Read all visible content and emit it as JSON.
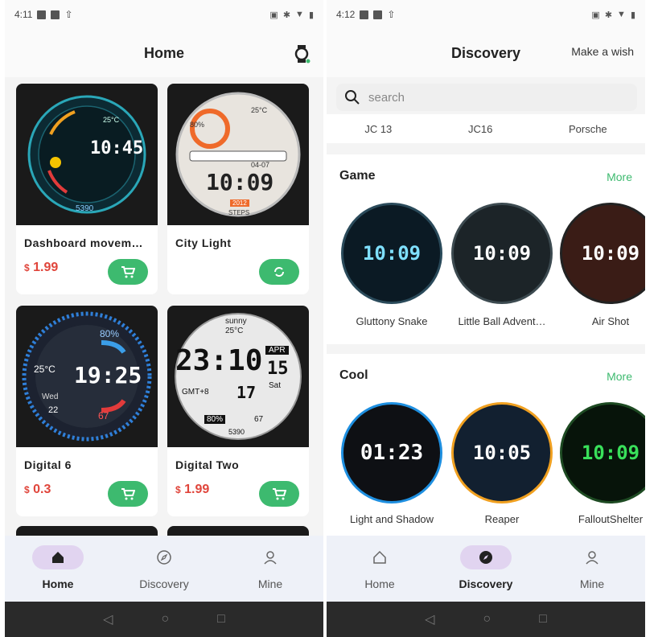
{
  "left": {
    "status": {
      "time": "4:11"
    },
    "header": {
      "title": "Home"
    },
    "cards": [
      {
        "title": "Dashboard movem…",
        "currency": "$",
        "price": "1.99",
        "face": {
          "time": "10:45",
          "info": "25°C",
          "steps": "5390"
        }
      },
      {
        "title": "City Light",
        "currency": "",
        "price": "",
        "face": {
          "time": "10:09",
          "temp": "25°C",
          "date": "04-07",
          "pct": "80%",
          "steps": "2012",
          "steps_label": "STEPS"
        }
      },
      {
        "title": "Digital 6",
        "currency": "$",
        "price": "0.3",
        "face": {
          "time": "19:25",
          "temp": "25°C",
          "day": "Wed",
          "date": "22",
          "pct": "80%",
          "hr": "67"
        }
      },
      {
        "title": "Digital Two",
        "currency": "$",
        "price": "1.99",
        "face": {
          "time": "23:10",
          "weather": "sunny",
          "temp": "25°C",
          "month": "APR",
          "date": "15",
          "day": "Sat",
          "zone": "GMT+8",
          "num": "17",
          "pct": "80%",
          "hr": "67",
          "steps": "5390"
        }
      }
    ],
    "tabs": [
      {
        "label": "Home",
        "icon": "home-icon"
      },
      {
        "label": "Discovery",
        "icon": "compass-icon"
      },
      {
        "label": "Mine",
        "icon": "user-icon"
      }
    ]
  },
  "right": {
    "status": {
      "time": "4:12"
    },
    "header": {
      "title": "Discovery",
      "wish": "Make a wish"
    },
    "search": {
      "placeholder": "search"
    },
    "brands": [
      "JC 13",
      "JC16",
      "Porsche"
    ],
    "game": {
      "title": "Game",
      "more": "More",
      "items": [
        {
          "label": "Gluttony Snake",
          "time": "10:09"
        },
        {
          "label": "Little Ball Advent…",
          "time": "10:09"
        },
        {
          "label": "Air Shot",
          "time": "10:09"
        }
      ]
    },
    "cool": {
      "title": "Cool",
      "more": "More",
      "items": [
        {
          "label": "Light and Shadow",
          "time": "01:23"
        },
        {
          "label": "Reaper",
          "time": "10:05"
        },
        {
          "label": "FalloutShelter",
          "time": "10:09"
        }
      ]
    },
    "tabs": [
      {
        "label": "Home",
        "icon": "home-icon"
      },
      {
        "label": "Discovery",
        "icon": "compass-icon"
      },
      {
        "label": "Mine",
        "icon": "user-icon"
      }
    ]
  },
  "colors": {
    "accent_green": "#3dba6f",
    "price_red": "#e0453b",
    "tab_pill": "#e1d4f0"
  }
}
